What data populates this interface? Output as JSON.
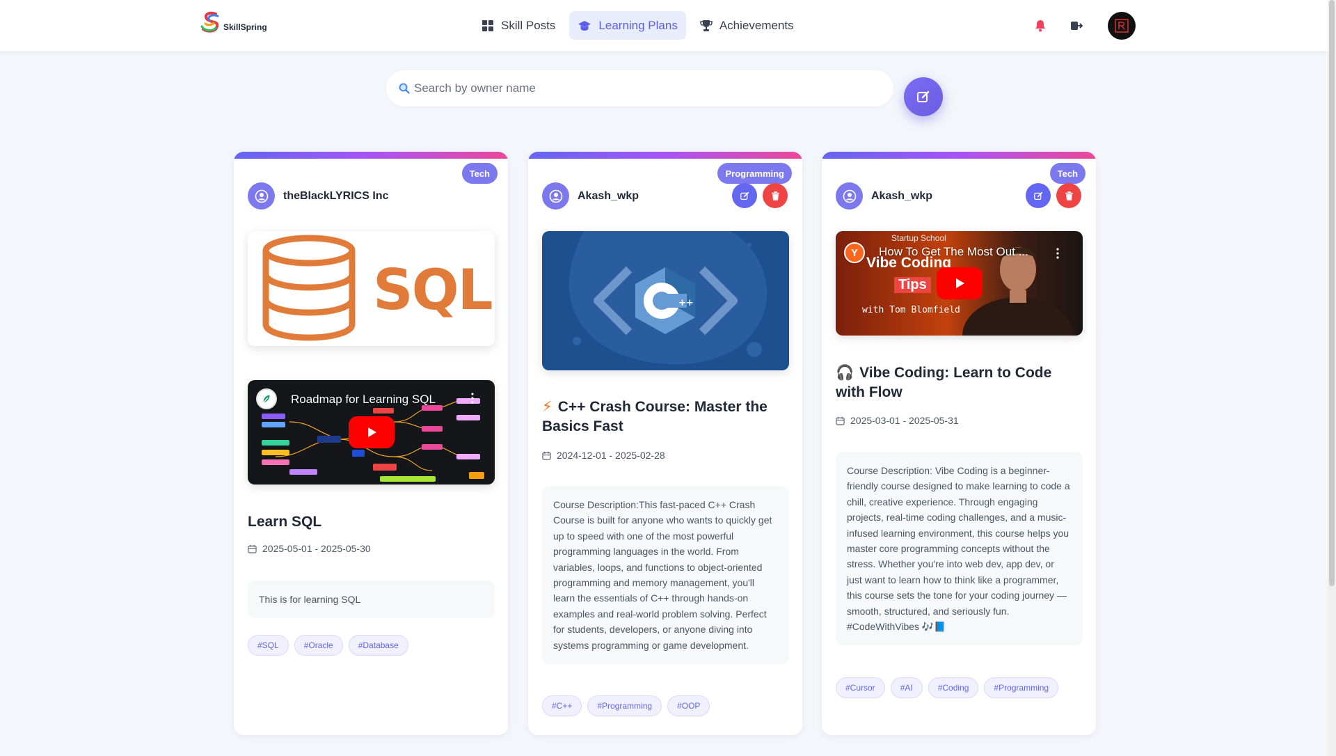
{
  "brand": {
    "name": "SkillSpring"
  },
  "nav": {
    "items": [
      {
        "label": "Skill Posts",
        "icon": "grid-icon"
      },
      {
        "label": "Learning Plans",
        "icon": "graduation-cap-icon"
      },
      {
        "label": "Achievements",
        "icon": "trophy-icon"
      }
    ],
    "active": "Learning Plans"
  },
  "search": {
    "placeholder": "Search by owner name",
    "value": ""
  },
  "cards": [
    {
      "category": "Tech",
      "owner": "theBlackLYRICS Inc",
      "image_text": "SQL",
      "video_title": "Roadmap for Learning SQL",
      "title": "Learn SQL",
      "dates": "2025-05-01 - 2025-05-30",
      "description": "This is for learning SQL",
      "tags": [
        "#SQL",
        "#Oracle",
        "#Database"
      ]
    },
    {
      "category": "Programming",
      "owner": "Akash_wkp",
      "title_emoji": "⚡",
      "title": "C++ Crash Course: Master the Basics Fast",
      "dates": "2024-12-01 - 2025-02-28",
      "description": "Course Description:This fast-paced C++ Crash Course is built for anyone who wants to quickly get up to speed with one of the most powerful programming languages in the world. From variables, loops, and functions to object-oriented programming and memory management, you'll learn the essentials of C++ through hands-on examples and real-world problem solving. Perfect for students, developers, or anyone diving into systems programming or game development.",
      "tags": [
        "#C++",
        "#Programming",
        "#OOP"
      ]
    },
    {
      "category": "Tech",
      "owner": "Akash_wkp",
      "video_channel": "Startup School",
      "video_title": "How To Get The Most Out ...",
      "video_overlay_1": "Vibe Coding",
      "video_overlay_2": "Tips",
      "video_overlay_3": "with Tom Blomfield",
      "title_emoji": "🎧",
      "title": "Vibe Coding: Learn to Code with Flow",
      "dates": "2025-03-01 - 2025-05-31",
      "description": "Course Description: Vibe Coding is a beginner-friendly course designed to make learning to code a chill, creative experience. Through engaging projects, real-time coding challenges, and a music-infused learning environment, this course helps you master core programming concepts without the stress. Whether you're into web dev, app dev, or just want to learn how to think like a programmer, this course sets the tone for your coding journey — smooth, structured, and seriously fun. #CodeWithVibes 🎶📘",
      "tags": [
        "#Cursor",
        "#AI",
        "#Coding",
        "#Programming"
      ]
    }
  ],
  "colors": {
    "accent": "#6366f1",
    "danger": "#ef4444",
    "background": "#f3f6fb",
    "sql_orange": "#e07b39",
    "cpp_blue": "#1e4f8f"
  }
}
